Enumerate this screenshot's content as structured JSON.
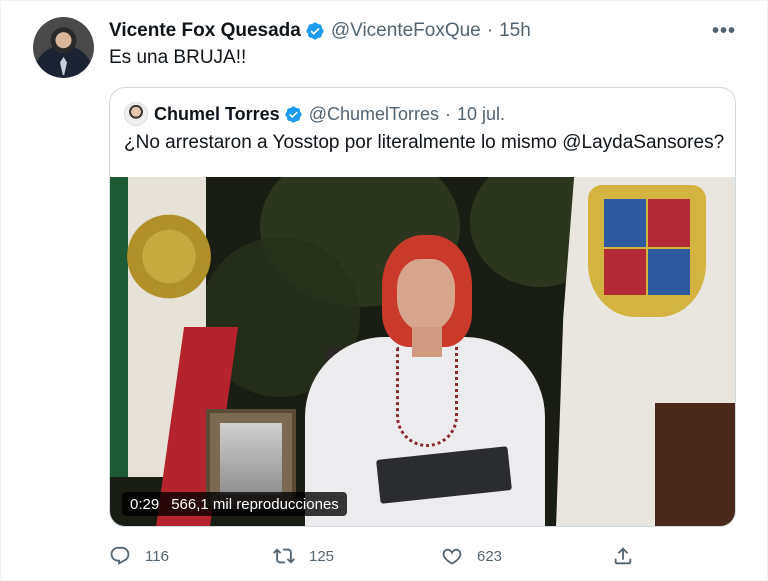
{
  "tweet": {
    "author_name": "Vicente Fox Quesada",
    "author_handle": "@VicenteFoxQue",
    "separator": "·",
    "time": "15h",
    "text": "Es una BRUJA!!",
    "more_label": "•••"
  },
  "quoted": {
    "author_name": "Chumel Torres",
    "author_handle": "@ChumelTorres",
    "separator": "·",
    "date": "10 jul.",
    "text": "¿No arrestaron a Yosstop por literalmente lo mismo @LaydaSansores?",
    "video": {
      "duration": "0:29",
      "views": "566,1 mil reproducciones"
    }
  },
  "actions": {
    "replies": "116",
    "retweets": "125",
    "likes": "623"
  },
  "colors": {
    "verified": "#1d9bf0",
    "secondary_text": "#536471",
    "border": "#cfd9de"
  }
}
